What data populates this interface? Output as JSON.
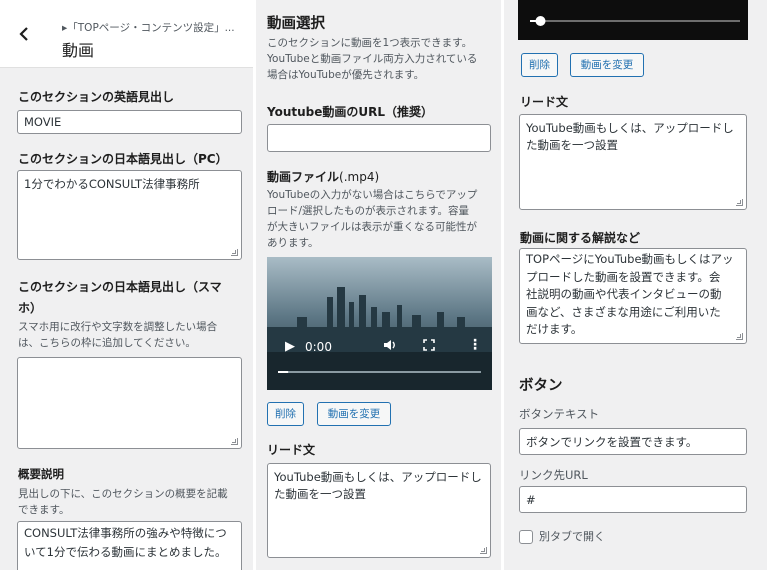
{
  "left_panel": {
    "back_symbol": "<",
    "breadcrumb": "▸「TOPページ・コンテンツ設定」...",
    "title": "動画",
    "en_heading_label": "このセクションの英語見出し",
    "en_heading_value": "MOVIE",
    "ja_heading_pc_label": "このセクションの日本語見出し（PC）",
    "ja_heading_pc_value": "1分でわかるCONSULT法律事務所",
    "ja_heading_sp_label_line1": "このセクションの日本語見出し（スマ",
    "ja_heading_sp_label_line2": "ホ）",
    "ja_heading_sp_desc_line1": "スマホ用に改行や文字数を調整したい場合",
    "ja_heading_sp_desc_line2": "は、こちらの枠に追加してください。",
    "ja_heading_sp_value": "",
    "summary_label": "概要説明",
    "summary_desc_line1": "見出しの下に、このセクションの概要を記載",
    "summary_desc_line2": "できます。",
    "summary_value_line1": "CONSULT法律事務所の強みや特徴につ",
    "summary_value_line2": "いて1分で伝わる動画にまとめました。"
  },
  "middle_panel": {
    "heading": "動画選択",
    "desc_line1": "このセクションに動画を1つ表示できます。",
    "desc_line2": "YouTubeと動画ファイル両方入力されている",
    "desc_line3": "場合はYouTubeが優先されます。",
    "youtube_label": "Youtube動画のURL（推奨）",
    "youtube_value": "",
    "file_label": "動画ファイル",
    "file_label_suffix": "(.mp4)",
    "file_desc_line1": "YouTubeの入力がない場合はこちらでアップ",
    "file_desc_line2": "ロード/選択したものが表示されます。容量",
    "file_desc_line3": "が大きいファイルは表示が重くなる可能性が",
    "file_desc_line4": "あります。",
    "video_time": "0:00",
    "video_progress": 0.05,
    "delete_button": "削除",
    "change_button": "動画を変更",
    "lead_label": "リード文",
    "lead_value_line1": "YouTube動画もしくは、アップロードし",
    "lead_value_line2": "た動画を一つ設置"
  },
  "right_panel": {
    "video_progress": 0.05,
    "delete_button": "削除",
    "change_button": "動画を変更",
    "lead_label": "リード文",
    "lead_value_line1": "YouTube動画もしくは、アップロードし",
    "lead_value_line2": "た動画を一つ設置",
    "explain_label": "動画に関する解説など",
    "explain_line1": "TOPページにYouTube動画もしくはアッ",
    "explain_line2": "プロードした動画を設置できます。会",
    "explain_line3": "社説明の動画や代表インタビューの動",
    "explain_line4": "画など、さまざまな用途にご利用いた",
    "explain_line5": "だけます。",
    "button_section_heading": "ボタン",
    "button_text_label": "ボタンテキスト",
    "button_text_value": "ボタンでリンクを設置できます。",
    "link_label": "リンク先URL",
    "link_value": "#",
    "new_tab_label": "別タブで開く"
  },
  "colors": {
    "accent": "#2271b1",
    "panel_bg": "#f0f0f1",
    "border": "#8c8f94"
  }
}
